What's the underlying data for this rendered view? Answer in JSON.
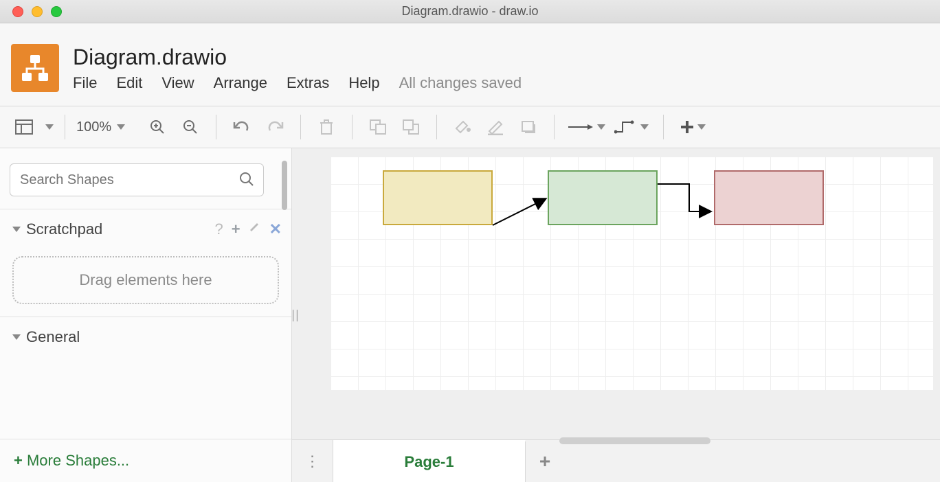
{
  "titlebar": {
    "title": "Diagram.drawio - draw.io"
  },
  "header": {
    "filename": "Diagram.drawio",
    "menu": {
      "file": "File",
      "edit": "Edit",
      "view": "View",
      "arrange": "Arrange",
      "extras": "Extras",
      "help": "Help"
    },
    "saved_status": "All changes saved"
  },
  "toolbar": {
    "zoom": "100%"
  },
  "sidebar": {
    "search_placeholder": "Search Shapes",
    "scratchpad_label": "Scratchpad",
    "scratchpad_help": "?",
    "dropzone_text": "Drag elements here",
    "general_label": "General",
    "more_shapes": "More Shapes..."
  },
  "canvas": {
    "shapes": [
      {
        "fill": "#f2eac0",
        "stroke": "#c9a93c"
      },
      {
        "fill": "#d6e8d5",
        "stroke": "#6ba45e"
      },
      {
        "fill": "#ecd2d2",
        "stroke": "#b06a6a"
      }
    ]
  },
  "tabs": {
    "page1": "Page-1"
  }
}
